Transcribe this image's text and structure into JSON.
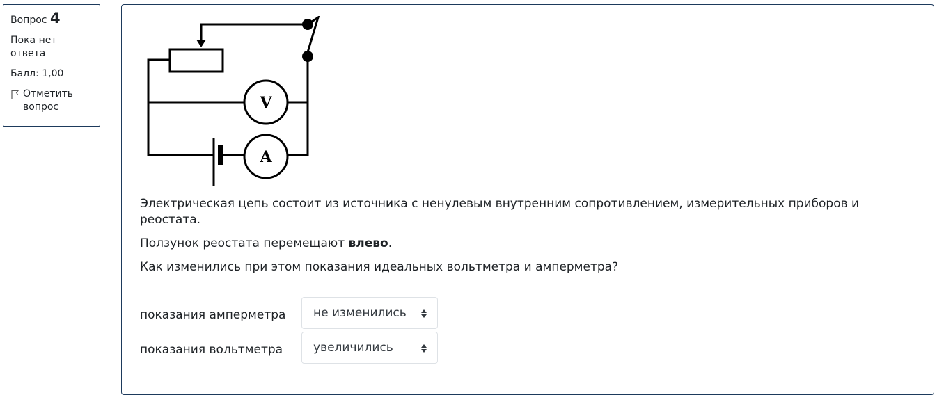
{
  "info": {
    "question_prefix": "Вопрос",
    "question_number": "4",
    "state": "Пока нет ответа",
    "grade": "Балл: 1,00",
    "flag_label": "Отметить вопрос"
  },
  "diagram": {
    "voltmeter_label": "V",
    "ammeter_label": "A"
  },
  "question": {
    "paragraph1": "Электрическая цепь состоит из источника с ненулевым внутренним сопротивлением, измерительных приборов и реостата.",
    "p2_before": "Ползунок реостата перемещают ",
    "p2_bold": "влево",
    "p2_after": ".",
    "paragraph3": "Как изменились при этом показания идеальных вольтметра и амперметра?"
  },
  "answers": [
    {
      "label": "показания амперметра",
      "selected": "не изменились"
    },
    {
      "label": "показания вольтметра",
      "selected": "увеличились"
    }
  ]
}
